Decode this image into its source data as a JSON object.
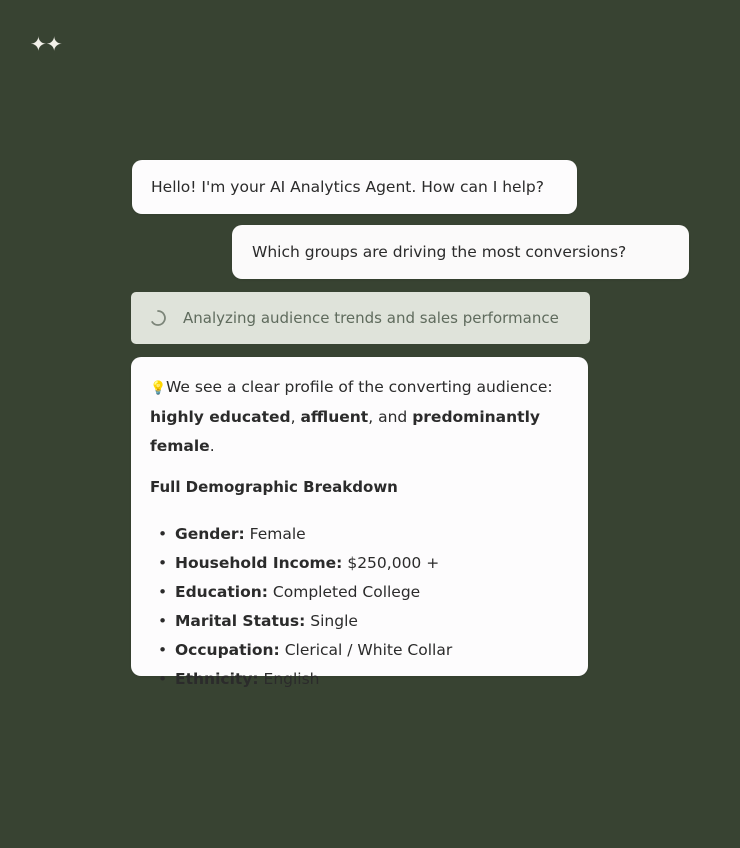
{
  "app": {
    "logo_glyph": "✦✦"
  },
  "chat": {
    "agent_greeting": "Hello! I'm your AI Analytics Agent. How can I help?",
    "user_question": "Which groups are driving the most conversions?",
    "status": {
      "text": "Analyzing audience trends and sales performance",
      "icon": "spinner-icon"
    },
    "answer": {
      "icon": "lightbulb-icon",
      "summary_prefix": "We see a clear profile of the converting audience:",
      "summary_b1": "highly educated",
      "summary_sep1": ", ",
      "summary_b2": "affluent",
      "summary_sep2": ", and ",
      "summary_b3": "predominantly female",
      "summary_end": ".",
      "section_title": "Full Demographic Breakdown",
      "items": [
        {
          "key": "Gender:",
          "value": "Female"
        },
        {
          "key": "Household Income:",
          "value": "$250,000 +"
        },
        {
          "key": "Education:",
          "value": "Completed College"
        },
        {
          "key": "Marital Status:",
          "value": "Single"
        },
        {
          "key": "Occupation:",
          "value": "Clerical / White Collar"
        },
        {
          "key": "Ethnicity:",
          "value": "English"
        }
      ]
    }
  },
  "colors": {
    "background": "#384332",
    "bubble": "#fdfcfd",
    "status_bg": "#dfe3da",
    "status_text": "#5f6b5d"
  }
}
